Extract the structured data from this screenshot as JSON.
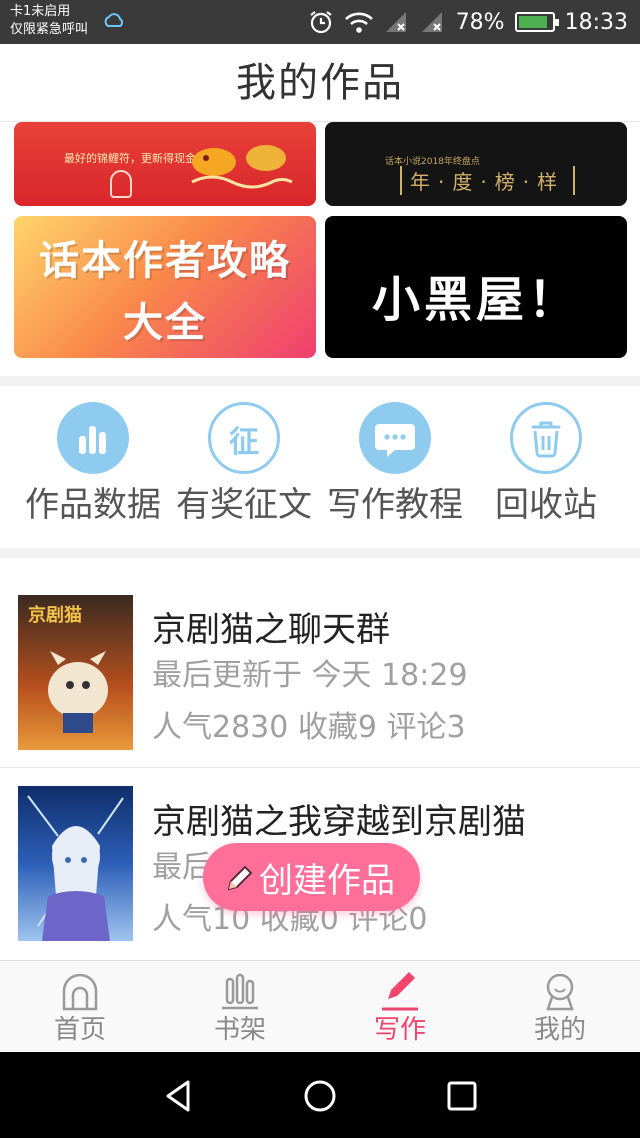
{
  "status_bar": {
    "carrier_line1": "卡1未启用",
    "carrier_line2": "仅限紧急呼叫",
    "battery": "78%",
    "time": "18:33"
  },
  "header": {
    "title": "我的作品"
  },
  "banners": {
    "koi_small_text": "最好的锦鲤符，更新得现金红包",
    "annual_small_text": "话本小说2018年终盘点",
    "annual_big_text": "年·度·榜·样",
    "guide_line1": "话本作者攻略",
    "guide_line2": "大全",
    "blackroom": "小黑屋！"
  },
  "shortcuts": [
    {
      "label": "作品数据",
      "icon": "bar-chart-icon"
    },
    {
      "label": "有奖征文",
      "icon": "contest-icon",
      "glyph": "征"
    },
    {
      "label": "写作教程",
      "icon": "chat-bubble-icon"
    },
    {
      "label": "回收站",
      "icon": "trash-icon"
    }
  ],
  "works": [
    {
      "title": "京剧猫之聊天群",
      "updated": "最后更新于 今天 18:29",
      "stats": "人气2830 收藏9 评论3",
      "cover_text": "京剧猫"
    },
    {
      "title": "京剧猫之我穿越到京剧猫",
      "updated": "最后",
      "stats": "人气10 收藏0 评论0"
    }
  ],
  "fab": {
    "label": "创建作品"
  },
  "tabs": [
    {
      "label": "首页",
      "icon": "home-icon"
    },
    {
      "label": "书架",
      "icon": "bookshelf-icon"
    },
    {
      "label": "写作",
      "icon": "pencil-icon",
      "active": true
    },
    {
      "label": "我的",
      "icon": "profile-icon"
    }
  ],
  "colors": {
    "accent": "#f0466e",
    "icon_blue": "#8ecbef",
    "fab": "#ff6f9a"
  }
}
